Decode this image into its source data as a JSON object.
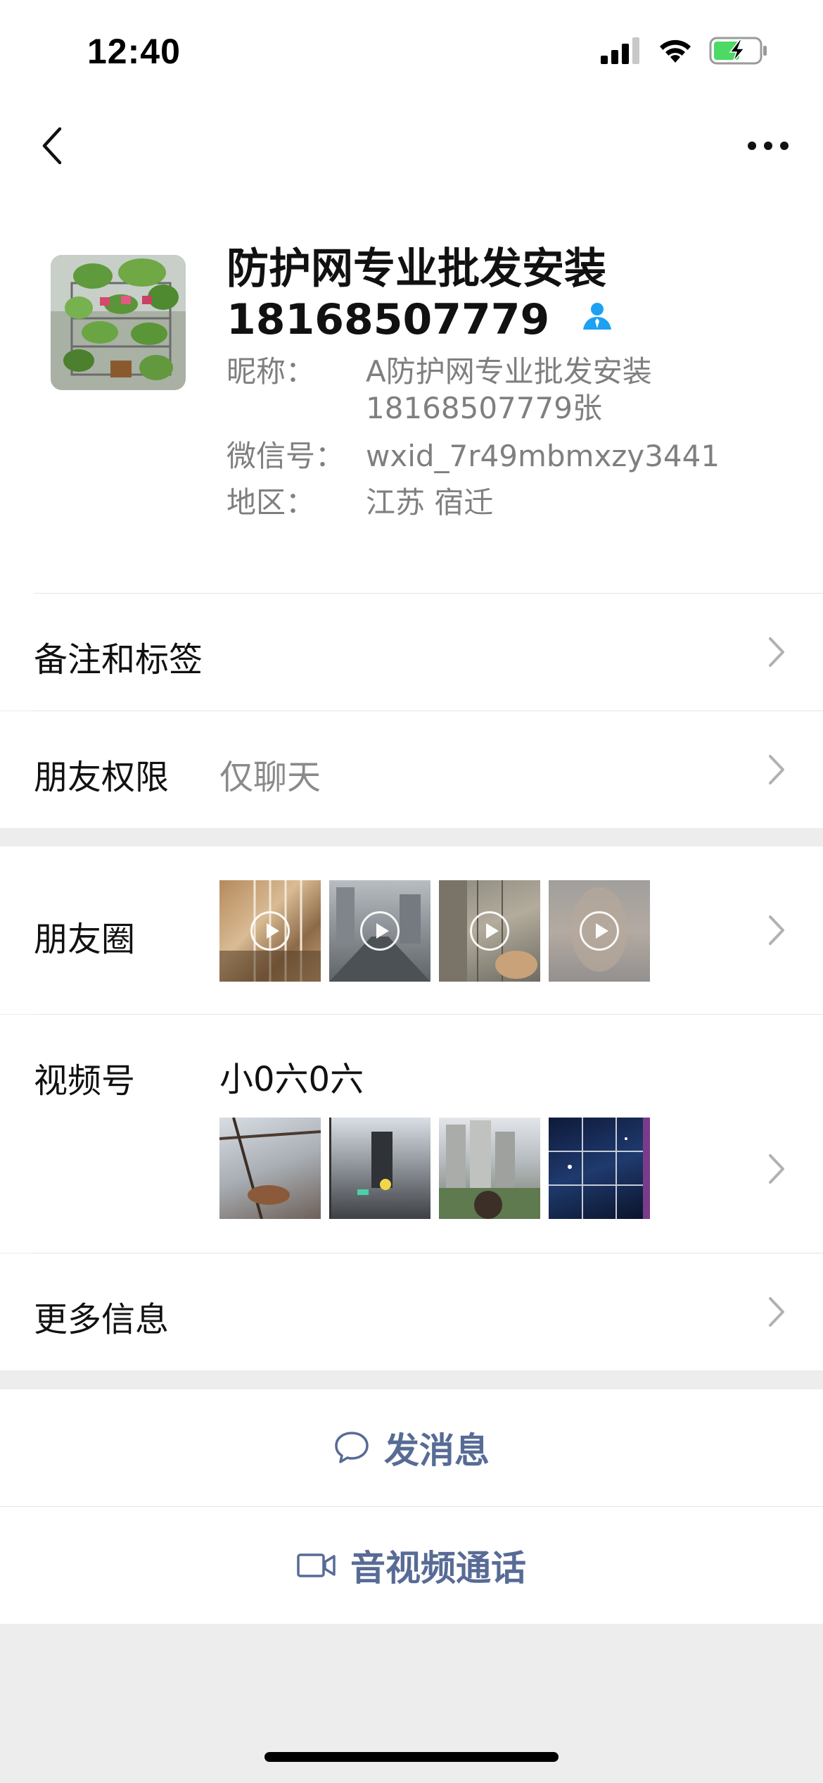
{
  "status_bar": {
    "time": "12:40"
  },
  "profile": {
    "name": "防护网专业批发安装18168507779",
    "nickname_label": "昵称：",
    "nickname_line1": "A防护网专业批发安装",
    "nickname_line2": "18168507779张",
    "wechat_id_label": "微信号：",
    "wechat_id": "wxid_7r49mbmxzy3441",
    "region_label": "地区：",
    "region": "江苏 宿迁"
  },
  "rows": {
    "remarks_label": "备注和标签",
    "permissions_label": "朋友权限",
    "permissions_value": "仅聊天",
    "moments_label": "朋友圈",
    "channels_label": "视频号",
    "channels_name": "小0六0六",
    "more_info_label": "更多信息"
  },
  "actions": {
    "message_label": "发消息",
    "call_label": "音视频通话"
  },
  "colors": {
    "link_blue": "#576b95",
    "verified_blue": "#1da1f2",
    "battery_green": "#4cd964"
  }
}
